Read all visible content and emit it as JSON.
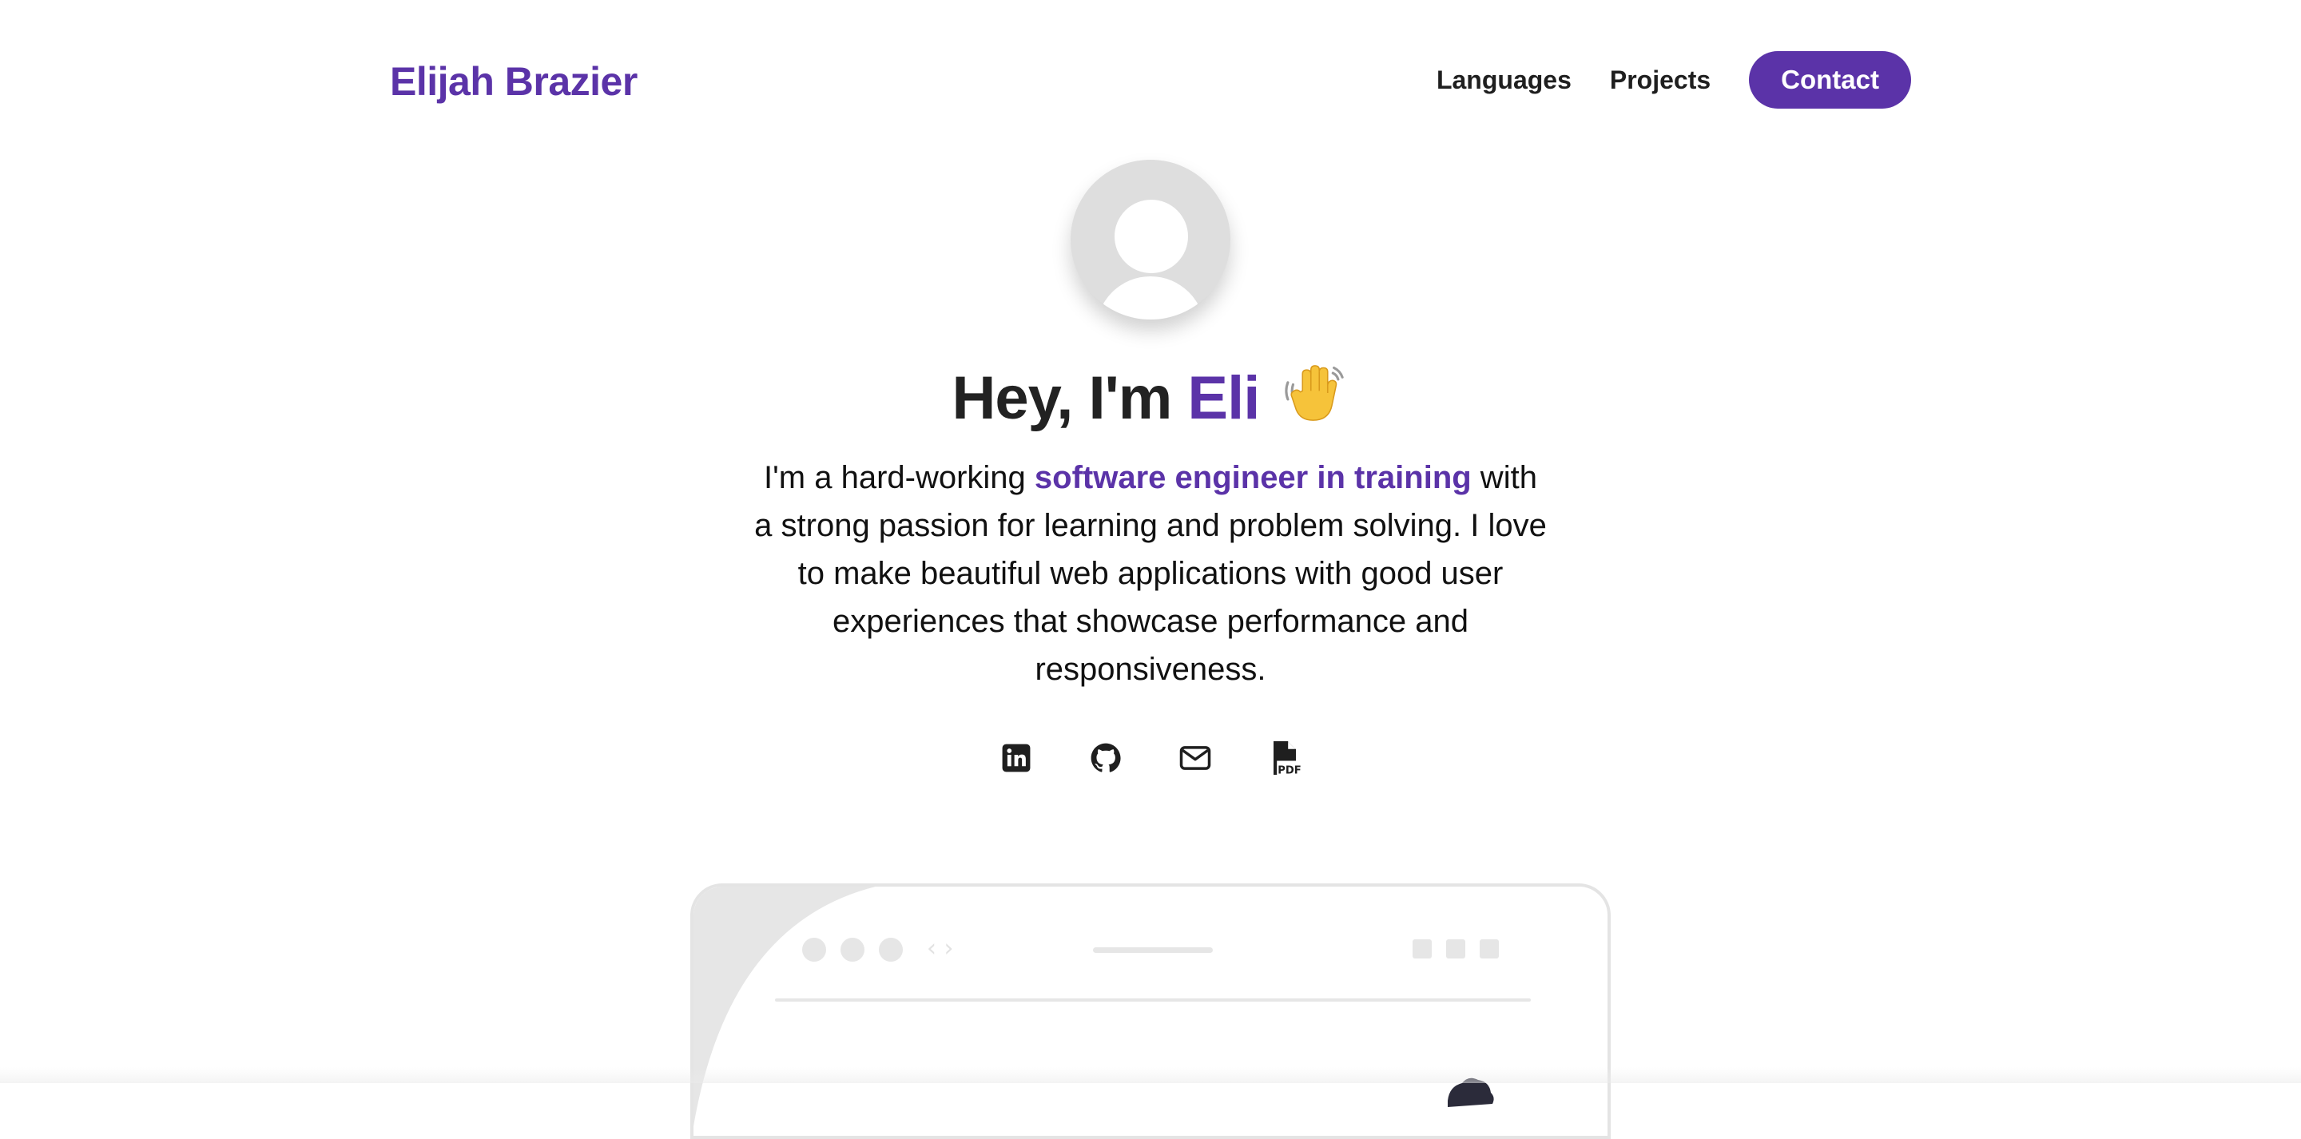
{
  "header": {
    "brand": "Elijah Brazier",
    "nav": [
      {
        "label": "Languages"
      },
      {
        "label": "Projects"
      }
    ],
    "contact_label": "Contact"
  },
  "hero": {
    "greeting_prefix": "Hey, I'm ",
    "greeting_name": "Eli",
    "wave_emoji": "waving-hand-icon",
    "intro_before": "I'm a hard-working ",
    "intro_highlight": "software engineer in training",
    "intro_after": " with a strong passion for learning and problem solving. I love to make beautiful web applications with good user experiences that showcase performance and responsiveness."
  },
  "socials": [
    {
      "icon": "linkedin-icon"
    },
    {
      "icon": "github-icon"
    },
    {
      "icon": "mail-icon"
    },
    {
      "icon": "pdf-resume-icon"
    }
  ],
  "illustration": {
    "url_glyph": "‹ ›"
  },
  "colors": {
    "accent": "#5b33a8",
    "text": "#1f1f1f",
    "muted": "#e6e6e6"
  }
}
